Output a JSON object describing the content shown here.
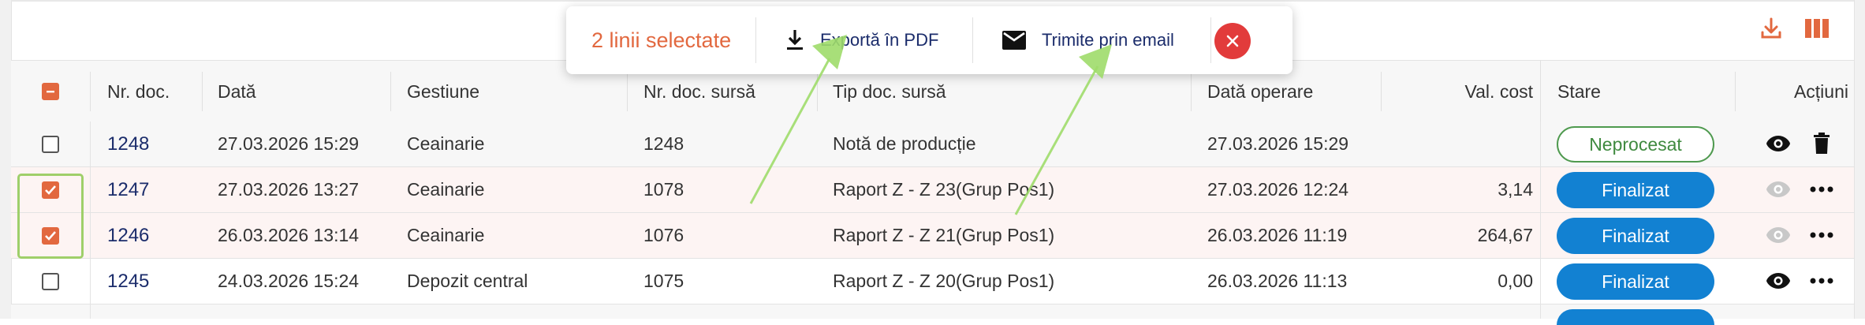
{
  "colors": {
    "accent": "#e2683f",
    "primary": "#1281d2",
    "success": "#4f9a4f",
    "danger": "#e23b3b",
    "link": "#1b2c6b"
  },
  "toolbar": {
    "download_icon": "download-icon",
    "columns_icon": "columns-icon"
  },
  "selection_bar": {
    "selected_text": "2 linii selectate",
    "export_pdf_label": "Exportă în PDF",
    "email_label": "Trimite prin email",
    "close_icon": "close-icon"
  },
  "table": {
    "headers": {
      "nr_doc": "Nr. doc.",
      "data": "Dată",
      "gestiune": "Gestiune",
      "nr_doc_sursa": "Nr. doc. sursă",
      "tip_doc_sursa": "Tip doc. sursă",
      "data_operare": "Dată operare",
      "val_cost": "Val. cost",
      "stare": "Stare",
      "actiuni": "Acțiuni"
    },
    "rows": [
      {
        "checked": false,
        "nr_doc": "1248",
        "data": "27.03.2026 15:29",
        "gestiune": "Ceainarie",
        "nr_doc_sursa": "1248",
        "tip_doc_sursa": "Notă de producție",
        "data_operare": "27.03.2026 15:29",
        "val_cost": "",
        "stare": "Neprocesat"
      },
      {
        "checked": true,
        "nr_doc": "1247",
        "data": "27.03.2026 13:27",
        "gestiune": "Ceainarie",
        "nr_doc_sursa": "1078",
        "tip_doc_sursa": "Raport Z - Z 23(Grup Pos1)",
        "data_operare": "27.03.2026 12:24",
        "val_cost": "3,14",
        "stare": "Finalizat"
      },
      {
        "checked": true,
        "nr_doc": "1246",
        "data": "26.03.2026 13:14",
        "gestiune": "Ceainarie",
        "nr_doc_sursa": "1076",
        "tip_doc_sursa": "Raport Z - Z 21(Grup Pos1)",
        "data_operare": "26.03.2026 11:19",
        "val_cost": "264,67",
        "stare": "Finalizat"
      },
      {
        "checked": false,
        "nr_doc": "1245",
        "data": "24.03.2026 15:24",
        "gestiune": "Depozit central",
        "nr_doc_sursa": "1075",
        "tip_doc_sursa": "Raport Z - Z 20(Grup Pos1)",
        "data_operare": "26.03.2026 11:13",
        "val_cost": "0,00",
        "stare": "Finalizat"
      }
    ]
  }
}
